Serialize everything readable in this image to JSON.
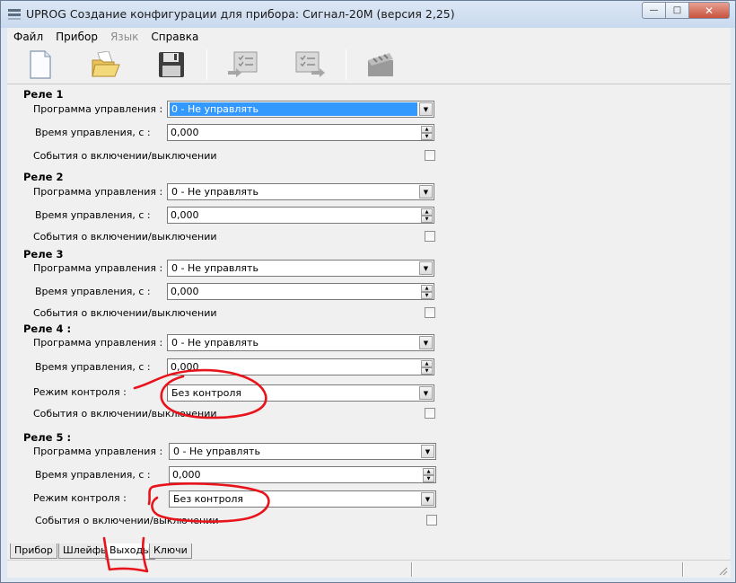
{
  "window": {
    "title": "UPROG  Создание конфигурации для прибора: Сигнал-20М (версия  2,25)"
  },
  "menu": [
    {
      "label": "Файл",
      "disabled": false
    },
    {
      "label": "Прибор",
      "disabled": false
    },
    {
      "label": "Язык",
      "disabled": true
    },
    {
      "label": "Справка",
      "disabled": false
    }
  ],
  "toolbar_icons": [
    "new-document-icon",
    "open-folder-icon",
    "save-disk-icon",
    "read-from-device-icon",
    "write-to-device-icon",
    "device-clock-icon"
  ],
  "relays": [
    {
      "title": "Реле 1",
      "program_label": "Программа управления :",
      "program_value": "0 - Не управлять",
      "time_label": "Время управления, с :",
      "time_value": "0,000",
      "events_label": "События о включении/выключении"
    },
    {
      "title": "Реле 2",
      "program_label": "Программа управления :",
      "program_value": "0 - Не управлять",
      "time_label": "Время управления, с :",
      "time_value": "0,000",
      "events_label": "События о включении/выключении"
    },
    {
      "title": "Реле 3",
      "program_label": "Программа управления :",
      "program_value": "0 - Не управлять",
      "time_label": "Время управления, с :",
      "time_value": "0,000",
      "events_label": "События о включении/выключении"
    },
    {
      "title": "Реле 4 :",
      "program_label": "Программа управления :",
      "program_value": "0 - Не управлять",
      "time_label": "Время управления, с :",
      "time_value": "0,000",
      "control_label": "Режим контроля :",
      "control_value": "Без контроля",
      "events_label": "События о включении/выключении"
    },
    {
      "title": "Реле 5 :",
      "program_label": "Программа управления :",
      "program_value": "0 - Не управлять",
      "time_label": "Время управления, с :",
      "time_value": "0,000",
      "control_label": "Режим контроля :",
      "control_value": "Без контроля",
      "events_label": "События о включении/выключении"
    }
  ],
  "tabs": [
    {
      "label": "Прибор",
      "active": false
    },
    {
      "label": "Шлейфы",
      "active": false
    },
    {
      "label": "Выходы",
      "active": true
    },
    {
      "label": "Ключи",
      "active": false
    }
  ],
  "colors": {
    "annotation": "#e8141c",
    "selection": "#3399ff"
  }
}
